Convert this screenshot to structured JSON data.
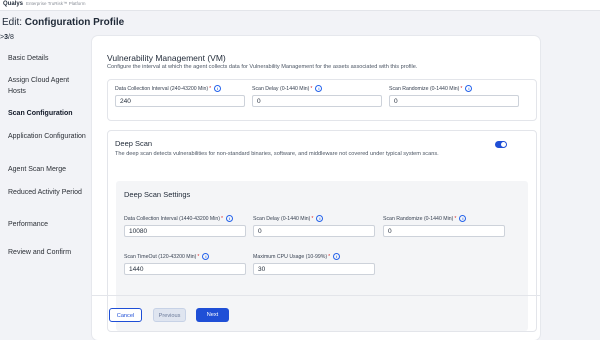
{
  "header": {
    "brand": "Qualys",
    "brand_subtitle": "Enterprise TruRisk™ Platform",
    "edit_prefix": "Edit:",
    "edit_title": "Configuration Profile",
    "step_current": "3",
    "step_total": "/8"
  },
  "sidebar": {
    "items": [
      {
        "label": "Basic Details"
      },
      {
        "label": "Assign Cloud Agent Hosts"
      },
      {
        "label": "Scan Configuration"
      },
      {
        "label": "Application Configuration"
      },
      {
        "label": "Agent Scan Merge"
      },
      {
        "label": "Reduced Activity Period"
      },
      {
        "label": "Performance"
      },
      {
        "label": "Review and Confirm"
      }
    ]
  },
  "vm": {
    "title": "Vulnerability Management (VM)",
    "description": "Configure the interval at which the agent collects data for Vulnerability Management for the assets associated with this profile.",
    "fields": [
      {
        "label": "Data Collection Interval (240-43200 Min)",
        "value": "240"
      },
      {
        "label": "Scan Delay (0-1440 Min)",
        "value": "0"
      },
      {
        "label": "Scan Randomize (0-1440 Min)",
        "value": "0"
      }
    ]
  },
  "deep_scan": {
    "title": "Deep Scan",
    "description": "The deep scan detects vulnerabilities for non-standard binaries, software, and middleware not covered under typical system scans.",
    "enabled": true,
    "settings_title": "Deep Scan Settings",
    "fields": [
      {
        "label": "Data Collection Interval (1440-43200 Min)",
        "value": "10080"
      },
      {
        "label": "Scan Delay (0-1440 Min)",
        "value": "0"
      },
      {
        "label": "Scan Randomize (0-1440 Min)",
        "value": "0"
      },
      {
        "label": "Scan TimeOut (120-43200 Min)",
        "value": "1440"
      },
      {
        "label": "Maximum CPU Usage (10-99%)",
        "value": "30"
      }
    ]
  },
  "footer": {
    "cancel": "Cancel",
    "previous": "Previous",
    "next": "Next"
  },
  "colors": {
    "accent": "#1f4fd6",
    "required": "#d92d2d"
  },
  "icons": {
    "info": "info-icon"
  }
}
